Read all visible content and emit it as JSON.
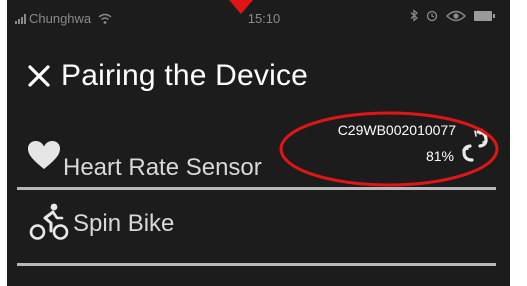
{
  "status_bar": {
    "carrier": "Chunghwa",
    "time": "15:10",
    "icons": [
      "signal-icon",
      "wifi-icon",
      "bluetooth-icon",
      "alarm-icon",
      "eye-icon",
      "battery-icon"
    ]
  },
  "header": {
    "close_icon": "close-icon",
    "title": "Pairing the Device"
  },
  "devices": [
    {
      "icon": "heart-icon",
      "label": "Heart Rate Sensor",
      "sensor_id": "C29WB002010077",
      "battery": "81%",
      "status_icon": "connected-link-icon"
    },
    {
      "icon": "cyclist-icon",
      "label": "Spin Bike"
    }
  ],
  "colors": {
    "background": "#1c1c1c",
    "text": "#d8d8d8",
    "annotation": "#e01616",
    "divider": "#b8b8b8"
  }
}
